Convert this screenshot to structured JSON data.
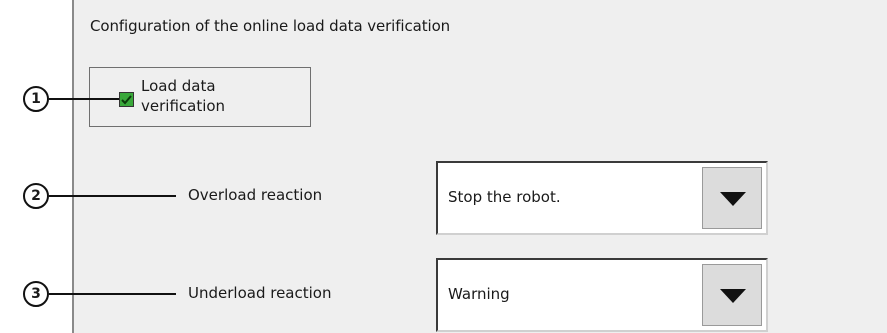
{
  "panel": {
    "title": "Configuration of the online load data verification"
  },
  "load_data_verification": {
    "label_line1": "Load data",
    "label_line2": "verification",
    "checked": true,
    "check_color": "#39a83a"
  },
  "overload": {
    "label": "Overload reaction",
    "value": "Stop the robot.",
    "icon": "chevron-down-icon"
  },
  "underload": {
    "label": "Underload reaction",
    "value": "Warning",
    "icon": "chevron-down-icon"
  },
  "callouts": [
    "1",
    "2",
    "3"
  ]
}
